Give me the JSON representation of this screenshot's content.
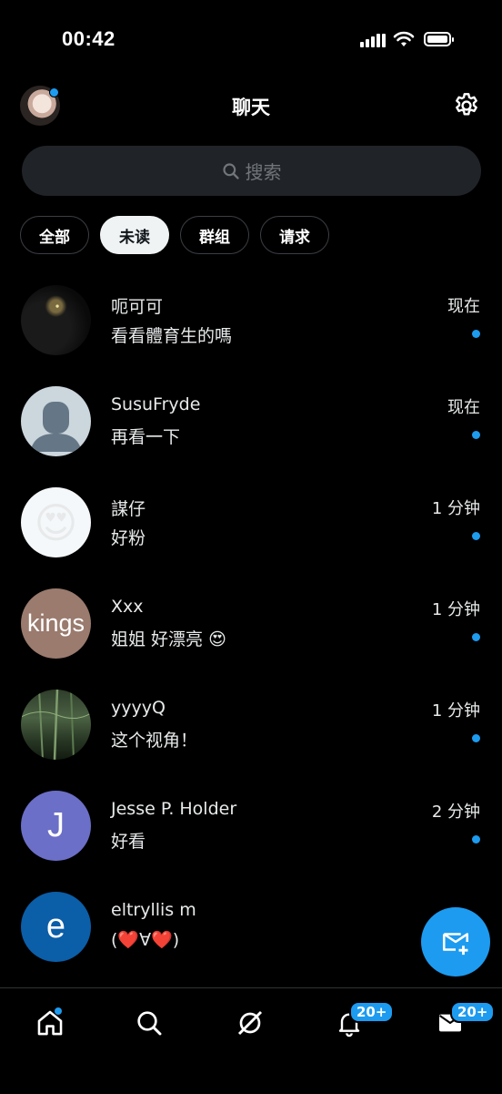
{
  "status_bar": {
    "time": "00:42"
  },
  "header": {
    "title": "聊天"
  },
  "search": {
    "placeholder": "搜索"
  },
  "filters": [
    {
      "label": "全部",
      "active": false
    },
    {
      "label": "未读",
      "active": true
    },
    {
      "label": "群组",
      "active": false
    },
    {
      "label": "请求",
      "active": false
    }
  ],
  "conversations": [
    {
      "name": "呃可可",
      "message": "看看體育生的嗎",
      "time": "现在",
      "unread": true
    },
    {
      "name": "SusuFryde",
      "message": "再看一下",
      "time": "现在",
      "unread": true
    },
    {
      "name": "謀仔",
      "message": "好粉",
      "time": "1 分钟",
      "unread": true,
      "avatar_emoji": "😍"
    },
    {
      "name": "Xxx",
      "message": "姐姐 好漂亮",
      "message_emoji": "😍",
      "time": "1 分钟",
      "unread": true,
      "avatar_text": "kings"
    },
    {
      "name": "yyyyQ",
      "message": "这个视角！",
      "time": "1 分钟",
      "unread": true
    },
    {
      "name": "Jesse P. Holder",
      "message": "好看",
      "time": "2 分钟",
      "unread": true,
      "avatar_letter": "J",
      "avatar_color": "#6b6fc7"
    },
    {
      "name": "eltryllis m",
      "message_parts": [
        "(",
        "❤️",
        "∀",
        "❤️",
        ")"
      ],
      "avatar_letter": "e",
      "avatar_color": "#0b5ea8"
    }
  ],
  "bottom_nav": {
    "notifications_badge": "20+",
    "messages_badge": "20+"
  },
  "colors": {
    "accent": "#1d9bf0",
    "background": "#000000"
  }
}
